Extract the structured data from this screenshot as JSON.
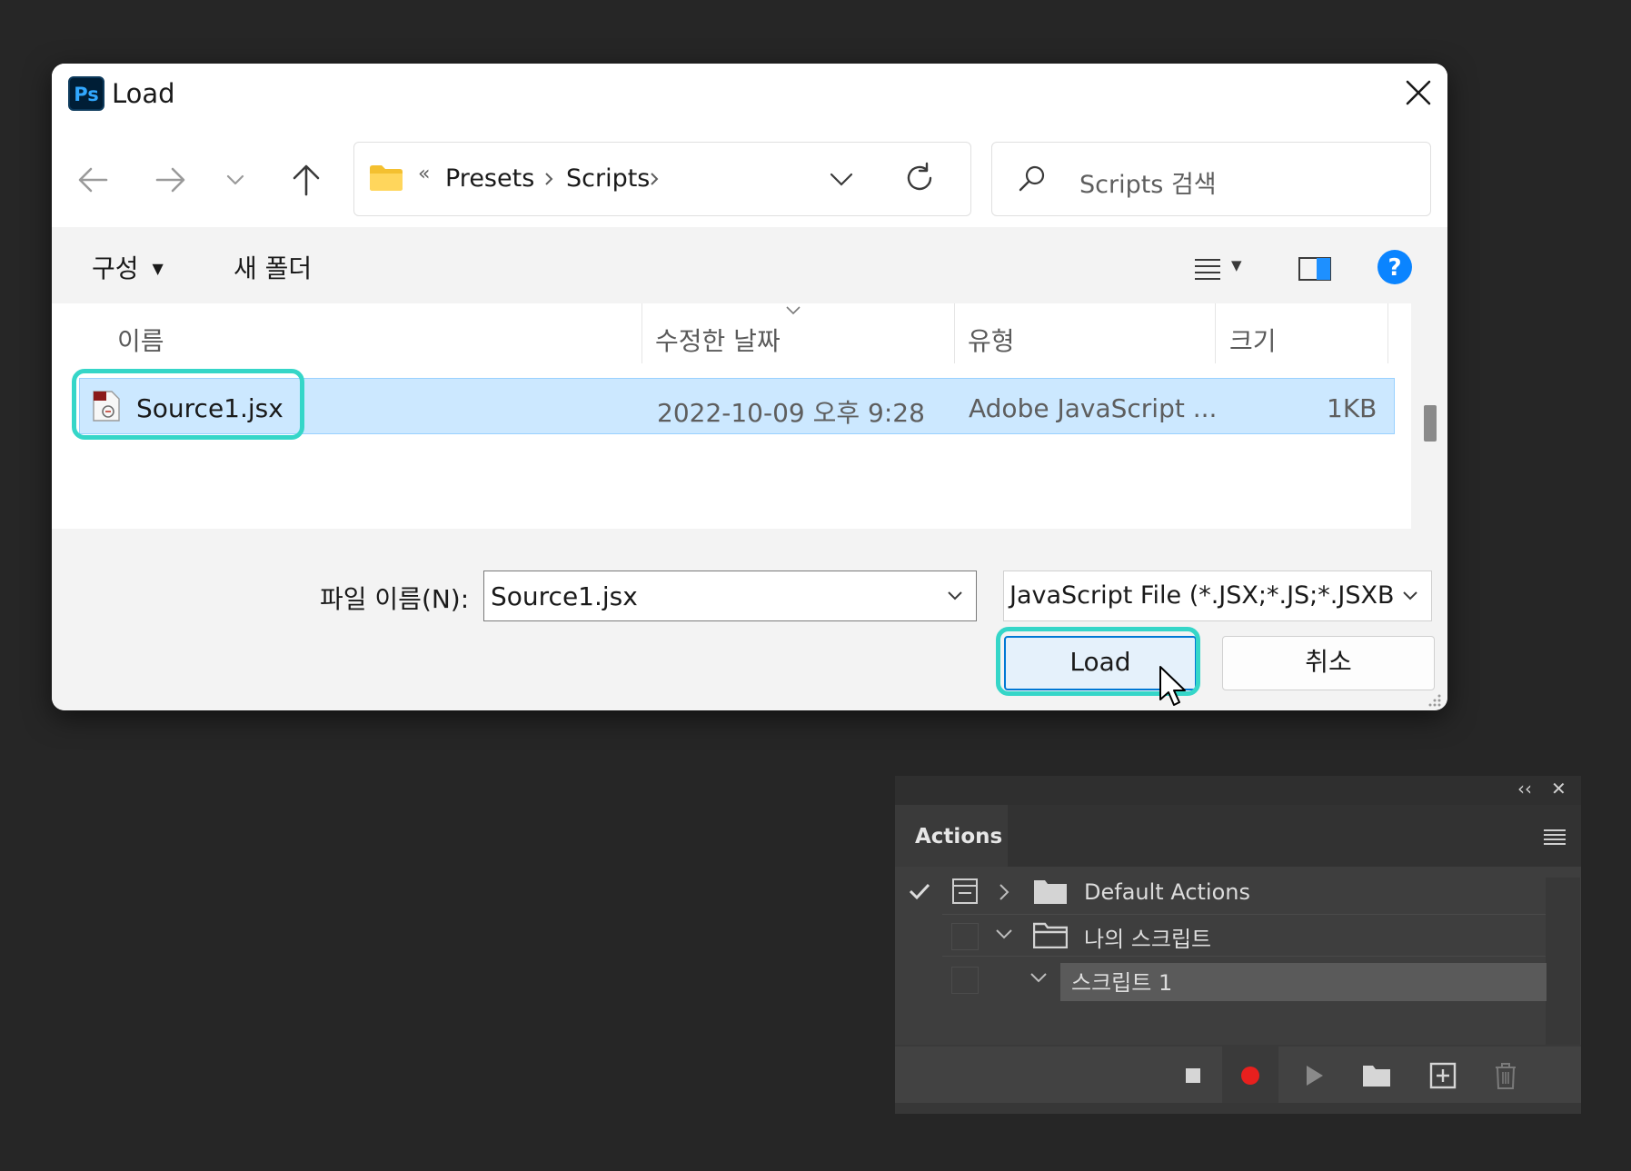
{
  "dialog": {
    "app_icon_text": "Ps",
    "title": "Load",
    "breadcrumb": {
      "overflow": "«",
      "items": [
        "Presets",
        "Scripts"
      ]
    },
    "search_placeholder": "Scripts 검색",
    "toolbar": {
      "organize": "구성",
      "new_folder": "새 폴더"
    },
    "columns": [
      "이름",
      "수정한 날짜",
      "유형",
      "크기"
    ],
    "files": [
      {
        "name": "Source1.jsx",
        "modified": "2022-10-09 오후 9:28",
        "type": "Adobe JavaScript ...",
        "size": "1KB"
      }
    ],
    "file_name_label": "파일 이름(N):",
    "file_name_value": "Source1.jsx",
    "file_type_value": "JavaScript File (*.JSX;*.JS;*.JSXB",
    "load_button": "Load",
    "cancel_button": "취소"
  },
  "actions_panel": {
    "collapse_glyph": "‹‹",
    "close_glyph": "✕",
    "tab": "Actions",
    "items": [
      {
        "label": "Default Actions"
      },
      {
        "label": "나의 스크립트"
      },
      {
        "label": "스크립트 1"
      }
    ]
  },
  "colors": {
    "highlight": "#35d6c8",
    "selection": "#cce8ff",
    "record": "#e8201e",
    "help": "#0a84ff"
  }
}
